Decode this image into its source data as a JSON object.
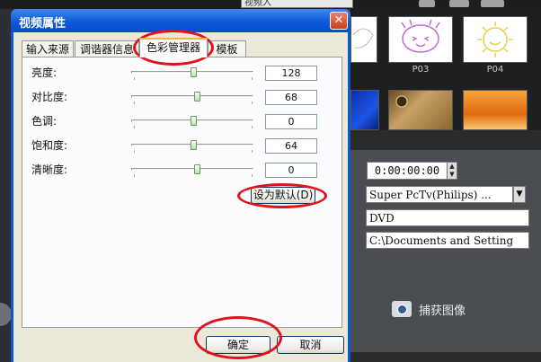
{
  "background_app": {
    "top_field_value": "视频入",
    "thumbnails": [
      {
        "label": "P03"
      },
      {
        "label": "P04"
      }
    ],
    "timecode": "0:00:00:00",
    "device_value": "Super PcTv(Philips) ...",
    "format_value": "DVD",
    "path_value": "C:\\Documents and Setting",
    "capture_label": "捕获图像"
  },
  "dialog": {
    "title": "视频属性",
    "close_glyph": "✕",
    "tabs": [
      {
        "label": "输入来源"
      },
      {
        "label": "调谐器信息"
      },
      {
        "label": "色彩管理器",
        "active": true
      },
      {
        "label": "模板"
      }
    ],
    "settings": [
      {
        "label": "亮度:",
        "value": "128"
      },
      {
        "label": "对比度:",
        "value": "68"
      },
      {
        "label": "色调:",
        "value": "0"
      },
      {
        "label": "饱和度:",
        "value": "64"
      },
      {
        "label": "清晰度:",
        "value": "0"
      }
    ],
    "default_button": "设为默认(D)",
    "ok_button": "确定",
    "cancel_button": "取消"
  },
  "annotation_color": "#e0121b"
}
